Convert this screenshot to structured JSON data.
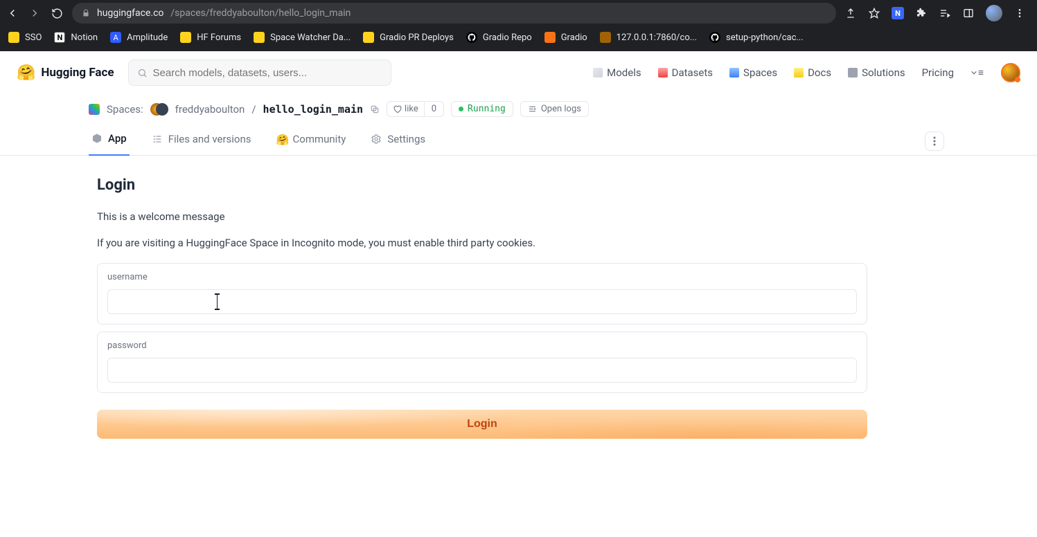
{
  "browser": {
    "url_domain": "huggingface.co",
    "url_path": "/spaces/freddyaboulton/hello_login_main",
    "bookmarks": [
      {
        "label": "SSO",
        "icon": "hf"
      },
      {
        "label": "Notion",
        "icon": "notion"
      },
      {
        "label": "Amplitude",
        "icon": "amp"
      },
      {
        "label": "HF Forums",
        "icon": "hf"
      },
      {
        "label": "Space Watcher Da...",
        "icon": "hf"
      },
      {
        "label": "Gradio PR Deploys",
        "icon": "hf"
      },
      {
        "label": "Gradio Repo",
        "icon": "gh"
      },
      {
        "label": "Gradio",
        "icon": "gr"
      },
      {
        "label": "127.0.0.1:7860/co...",
        "icon": "gr2"
      },
      {
        "label": "setup-python/cac...",
        "icon": "gh"
      }
    ]
  },
  "header": {
    "brand": "Hugging Face",
    "search_placeholder": "Search models, datasets, users...",
    "nav": [
      "Models",
      "Datasets",
      "Spaces",
      "Docs",
      "Solutions",
      "Pricing"
    ]
  },
  "breadcrumb": {
    "spaces_label": "Spaces:",
    "owner": "freddyaboulton",
    "space": "hello_login_main",
    "like_label": "like",
    "like_count": "0",
    "status": "Running",
    "open_logs": "Open logs"
  },
  "tabs": {
    "app": "App",
    "files": "Files and versions",
    "community": "Community",
    "settings": "Settings"
  },
  "login": {
    "title": "Login",
    "welcome": "This is a welcome message",
    "notice": "If you are visiting a HuggingFace Space in Incognito mode, you must enable third party cookies.",
    "username_label": "username",
    "password_label": "password",
    "button": "Login"
  }
}
